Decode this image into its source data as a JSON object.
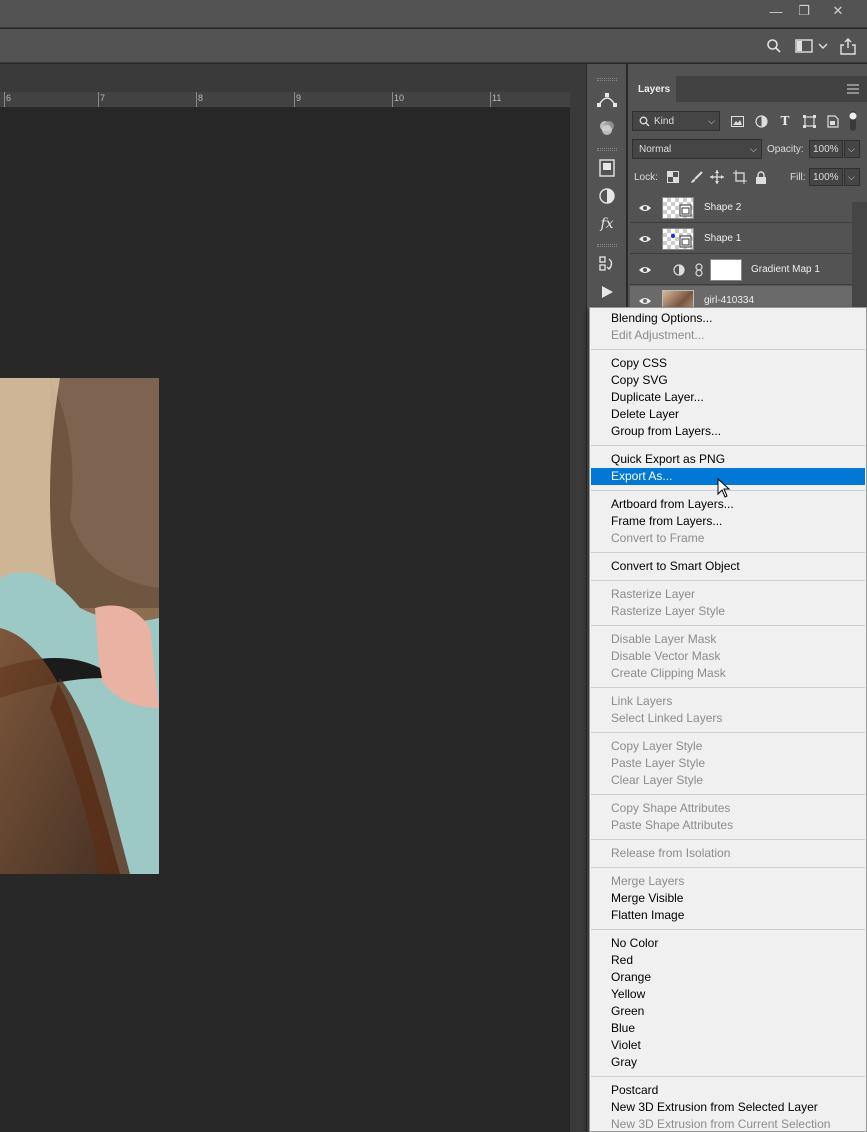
{
  "ruler": {
    "numbers": [
      "6",
      "7",
      "8",
      "9",
      "10",
      "11"
    ]
  },
  "layers_panel": {
    "tab_label": "Layers",
    "filter_kind": "Kind",
    "blend_mode": "Normal",
    "opacity_label": "Opacity:",
    "opacity_value": "100%",
    "lock_label": "Lock:",
    "fill_label": "Fill:",
    "fill_value": "100%",
    "layers": [
      {
        "name": "Shape 2"
      },
      {
        "name": "Shape 1"
      },
      {
        "name": "Gradient Map 1"
      },
      {
        "name": "girl-410334"
      }
    ]
  },
  "context_menu": {
    "items": [
      {
        "label": "Blending Options...",
        "enabled": true
      },
      {
        "label": "Edit Adjustment...",
        "enabled": false
      },
      {
        "label": "Copy CSS",
        "enabled": true
      },
      {
        "label": "Copy SVG",
        "enabled": true
      },
      {
        "label": "Duplicate Layer...",
        "enabled": true
      },
      {
        "label": "Delete Layer",
        "enabled": true
      },
      {
        "label": "Group from Layers...",
        "enabled": true
      },
      {
        "label": "Quick Export as PNG",
        "enabled": true
      },
      {
        "label": "Export As...",
        "enabled": true,
        "highlighted": true
      },
      {
        "label": "Artboard from Layers...",
        "enabled": true
      },
      {
        "label": "Frame from Layers...",
        "enabled": true
      },
      {
        "label": "Convert to Frame",
        "enabled": false
      },
      {
        "label": "Convert to Smart Object",
        "enabled": true
      },
      {
        "label": "Rasterize Layer",
        "enabled": false
      },
      {
        "label": "Rasterize Layer Style",
        "enabled": false
      },
      {
        "label": "Disable Layer Mask",
        "enabled": false
      },
      {
        "label": "Disable Vector Mask",
        "enabled": false
      },
      {
        "label": "Create Clipping Mask",
        "enabled": false
      },
      {
        "label": "Link Layers",
        "enabled": false
      },
      {
        "label": "Select Linked Layers",
        "enabled": false
      },
      {
        "label": "Copy Layer Style",
        "enabled": false
      },
      {
        "label": "Paste Layer Style",
        "enabled": false
      },
      {
        "label": "Clear Layer Style",
        "enabled": false
      },
      {
        "label": "Copy Shape Attributes",
        "enabled": false
      },
      {
        "label": "Paste Shape Attributes",
        "enabled": false
      },
      {
        "label": "Release from Isolation",
        "enabled": false
      },
      {
        "label": "Merge Layers",
        "enabled": false
      },
      {
        "label": "Merge Visible",
        "enabled": true
      },
      {
        "label": "Flatten Image",
        "enabled": true
      },
      {
        "label": "No Color",
        "enabled": true
      },
      {
        "label": "Red",
        "enabled": true
      },
      {
        "label": "Orange",
        "enabled": true
      },
      {
        "label": "Yellow",
        "enabled": true
      },
      {
        "label": "Green",
        "enabled": true
      },
      {
        "label": "Blue",
        "enabled": true
      },
      {
        "label": "Violet",
        "enabled": true
      },
      {
        "label": "Gray",
        "enabled": true
      },
      {
        "label": "Postcard",
        "enabled": true
      },
      {
        "label": "New 3D Extrusion from Selected Layer",
        "enabled": true
      },
      {
        "label": "New 3D Extrusion from Current Selection",
        "enabled": false
      }
    ]
  },
  "colors": {
    "highlight": "#0078d7",
    "panel": "#535353",
    "canvas": "#282828"
  }
}
